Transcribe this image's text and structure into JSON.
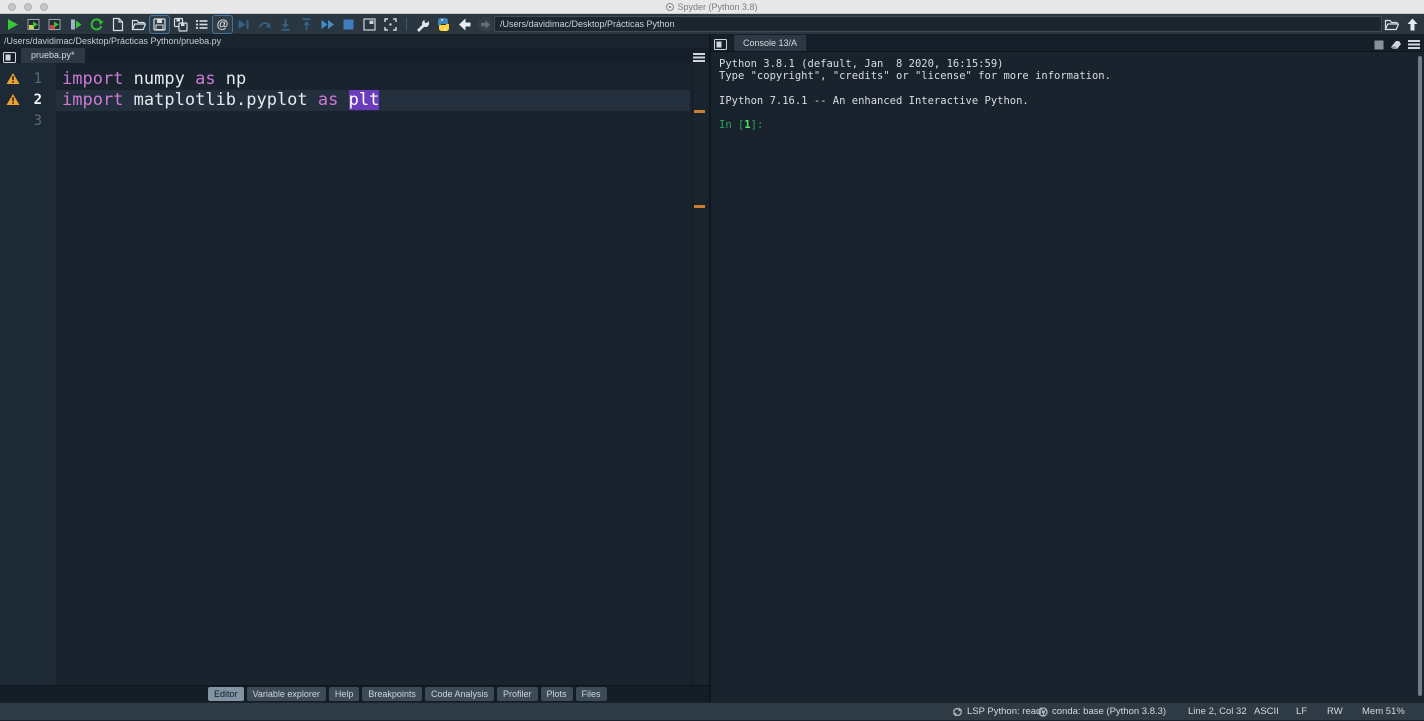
{
  "titlebar": {
    "title": "Spyder (Python 3.8)"
  },
  "toolbar": {
    "icons": [
      "run-file",
      "run-cell",
      "run-cell-and-advance",
      "run-selection",
      "rerun-cell",
      "new-file",
      "open-file",
      "save-file",
      "save-all",
      "file-switcher",
      "at-symbol",
      "debug-run",
      "step-over",
      "step-into",
      "step-return",
      "continue-execution",
      "stop-debugging",
      "maximize-pane",
      "fullscreen",
      "preferences",
      "pythonpath-manager",
      "back",
      "forward"
    ],
    "path_bar": {
      "value": "/Users/davidimac/Desktop/Prácticas Python"
    },
    "right_icons": [
      "browse-working-directory",
      "parent-directory"
    ]
  },
  "editor": {
    "breadcrumb": "/Users/davidimac/Desktop/Prácticas Python/prueba.py",
    "tab_label": "prueba.py*",
    "line1": {
      "num": "1",
      "kw1": "import",
      "id1": " numpy ",
      "kw2": "as",
      "id2": " np"
    },
    "line2": {
      "num": "2",
      "kw1": "import",
      "id1": " matplotlib.pyplot ",
      "kw2": "as",
      "sp": " ",
      "sel": "plt"
    },
    "line3": {
      "num": "3"
    },
    "warnings_on_lines": [
      1,
      2
    ]
  },
  "panel_tabs": {
    "items": [
      "Editor",
      "Variable explorer",
      "Help",
      "Breakpoints",
      "Code Analysis",
      "Profiler",
      "Plots",
      "Files"
    ],
    "active": "Editor"
  },
  "console": {
    "tab_label": "Console 13/A",
    "menu_icons": [
      "interrupt-kernel",
      "remove-variables",
      "options-menu"
    ],
    "lines": [
      "Python 3.8.1 (default, Jan  8 2020, 16:15:59)",
      "Type \"copyright\", \"credits\" or \"license\" for more information.",
      "IPython 7.16.1 -- An enhanced Interactive Python."
    ],
    "prompt": {
      "pre": "In [",
      "num": "1",
      "post": "]:"
    }
  },
  "status": {
    "lsp": "LSP Python: ready",
    "conda": "conda: base (Python 3.8.3)",
    "cursor": "Line 2, Col 32",
    "encoding": "ASCII",
    "eol": "LF",
    "permissions": "RW",
    "memory": "Mem 51%"
  },
  "colors": {
    "keyword": "#cc7ad6",
    "selection_bg": "#6a3cbc",
    "warning_orange": "#eda12f",
    "prompt_green": "#2aa35a",
    "prompt_bright_green": "#52e06a",
    "debug_blue": "#3f8ecb",
    "run_green": "#37c837",
    "editor_bg": "#19232d",
    "chrome_bg": "#2a3640"
  }
}
